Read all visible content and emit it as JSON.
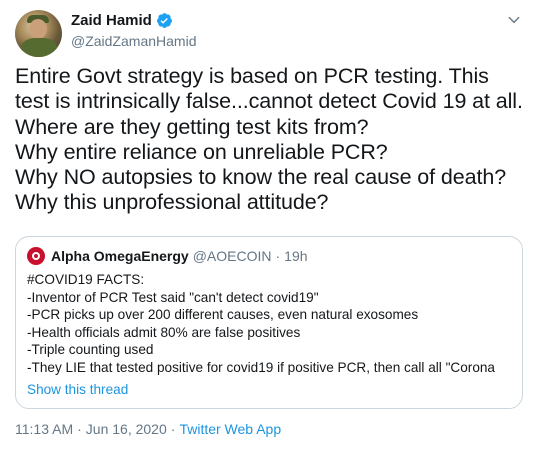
{
  "author": {
    "display_name": "Zaid Hamid",
    "handle": "@ZaidZamanHamid"
  },
  "tweet": {
    "text": "Entire Govt strategy is based on PCR testing. This test is intrinsically false...cannot detect Covid 19 at all.\nWhere are they getting test kits from?\nWhy entire reliance on unreliable PCR?\nWhy NO autopsies to know the real cause of death?\nWhy this unprofessional attitude?"
  },
  "quoted": {
    "display_name": "Alpha OmegaEnergy",
    "handle": "@AOECOIN",
    "separator": "·",
    "age": "19h",
    "text": "#COVID19 FACTS:\n-Inventor of PCR Test said \"can't detect covid19\"\n-PCR picks up over 200 different causes, even natural exosomes\n-Health officials admit 80% are false positives\n-Triple counting used\n-They LIE that tested positive for covid19 if positive PCR, then call all \"Corona",
    "show_thread": "Show this thread"
  },
  "meta": {
    "time": "11:13 AM",
    "sep1": "·",
    "date": "Jun 16, 2020",
    "sep2": "·",
    "source": "Twitter Web App"
  },
  "colors": {
    "accent": "#1b95e0",
    "verified": "#1da1f2",
    "muted": "#657786",
    "border": "#ccd6dd"
  },
  "icons": [
    "verified-badge-icon",
    "chevron-down-icon"
  ]
}
